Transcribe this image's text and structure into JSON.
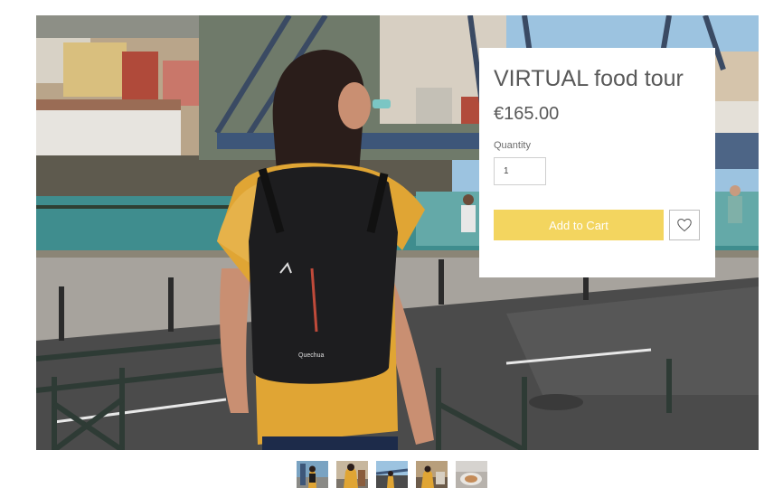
{
  "product": {
    "title": "VIRTUAL food tour",
    "price": "€165.00",
    "quantity_label": "Quantity",
    "quantity_value": "1",
    "add_to_cart_label": "Add to Cart"
  },
  "icons": {
    "wishlist": "heart-icon"
  },
  "colors": {
    "add_to_cart_bg": "#f3d55f",
    "text": "#595959"
  },
  "gallery": {
    "thumbnail_count": 5,
    "selected_index": 0
  }
}
